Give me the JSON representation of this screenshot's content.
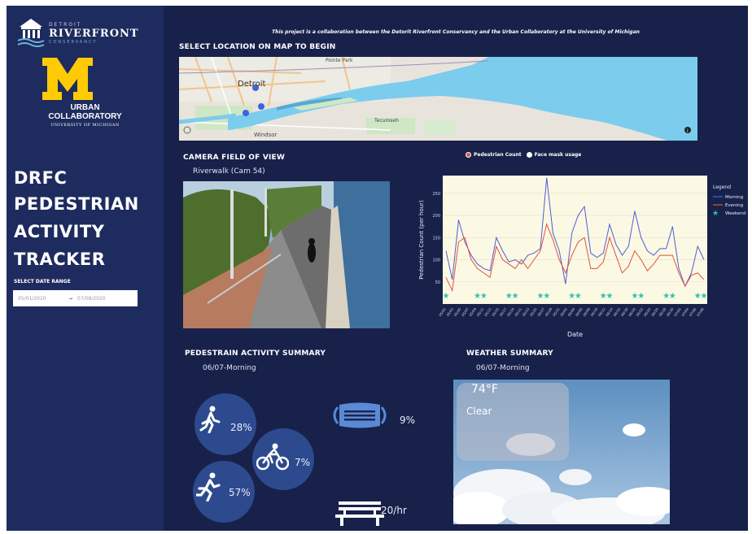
{
  "sidebar": {
    "org_top": "DETROIT",
    "org_name": "RIVERFRONT",
    "org_bottom": "CONSERVANCY",
    "um_letter": "M",
    "um_line1": "URBAN",
    "um_line2": "COLLABORATORY",
    "um_line3": "UNIVERSITY OF MICHIGAN",
    "title": [
      "DRFC",
      "PEDESTRIAN",
      "ACTIVITY",
      "TRACKER"
    ],
    "date_range_label": "SELECT DATE RANGE",
    "date_start": "05/01/2020",
    "date_arrow": "→",
    "date_end": "07/08/2020"
  },
  "main": {
    "collab_note": "This project is a collaboration between the Detorit Riverfront Conservancy and the Urban Collaboratory at the University of Michigan",
    "map_title": "SELECT LOCATION ON MAP TO BEGIN",
    "map_labels": {
      "city": "Detroit",
      "windsor": "Windsor",
      "tecumseh": "Tecumseh",
      "pointe": "Pointe Park"
    },
    "camera_title": "CAMERA FIELD OF VIEW",
    "camera_name": "Riverwalk (Cam 54)",
    "toggle_pedestrian": "Pedestrian Count",
    "toggle_mask": "Face mask usage",
    "summary_title": "PEDESTRAIN ACTIVITY SUMMARY",
    "summary_period": "06/07-Morning",
    "walk_pct": "28%",
    "bike_pct": "7%",
    "run_pct": "57%",
    "mask_pct": "9%",
    "bench_rate": "20/hr",
    "weather_title": "WEATHER SUMMARY",
    "weather_period": "06/07-Morning",
    "temperature": "74°F",
    "condition": "Clear"
  },
  "chart_data": {
    "type": "line",
    "xlabel": "Date",
    "ylabel": "Pedestrian Count (per hour)",
    "ylim": [
      0,
      290
    ],
    "yticks": [
      50,
      100,
      150,
      200,
      250
    ],
    "legend_title": "Legend",
    "legend_placement": "right",
    "series": [
      {
        "name": "Morning",
        "color": "#4f5fd6",
        "values": [
          120,
          55,
          190,
          140,
          110,
          90,
          80,
          75,
          150,
          120,
          95,
          100,
          90,
          110,
          115,
          125,
          285,
          160,
          120,
          45,
          160,
          200,
          220,
          115,
          105,
          115,
          180,
          135,
          110,
          130,
          210,
          150,
          120,
          110,
          125,
          125,
          175,
          80,
          40,
          70,
          130,
          100
        ]
      },
      {
        "name": "Evening",
        "color": "#e0533a",
        "values": [
          60,
          30,
          140,
          150,
          100,
          80,
          70,
          60,
          130,
          100,
          90,
          80,
          100,
          80,
          100,
          120,
          180,
          145,
          100,
          70,
          110,
          140,
          150,
          80,
          80,
          95,
          150,
          110,
          70,
          85,
          120,
          100,
          75,
          90,
          110,
          110,
          110,
          70,
          40,
          65,
          70,
          55
        ]
      },
      {
        "name": "Weekend",
        "color": "#2fc5a3",
        "marker": "star",
        "values": [
          18,
          null,
          null,
          null,
          null,
          18,
          18,
          null,
          null,
          null,
          18,
          18,
          null,
          null,
          null,
          18,
          18,
          null,
          null,
          null,
          18,
          18,
          null,
          null,
          null,
          18,
          18,
          null,
          null,
          null,
          18,
          18,
          null,
          null,
          null,
          18,
          18,
          null,
          null,
          null,
          18,
          18
        ]
      }
    ],
    "x": [
      "05/01",
      "05/03",
      "05/05",
      "05/07",
      "05/09",
      "05/11",
      "05/13",
      "05/15",
      "05/17",
      "05/19",
      "05/21",
      "05/23",
      "05/25",
      "05/27",
      "05/29",
      "05/31",
      "06/02",
      "06/04",
      "06/06",
      "06/08",
      "06/10",
      "06/12",
      "06/14",
      "06/16",
      "06/18",
      "06/20",
      "06/22",
      "06/24",
      "06/26",
      "06/28",
      "06/30",
      "07/02",
      "07/04",
      "07/06",
      "07/08"
    ],
    "colors": {
      "plot_bg": "#fbf8e4",
      "page_bg": "#18214a"
    }
  }
}
